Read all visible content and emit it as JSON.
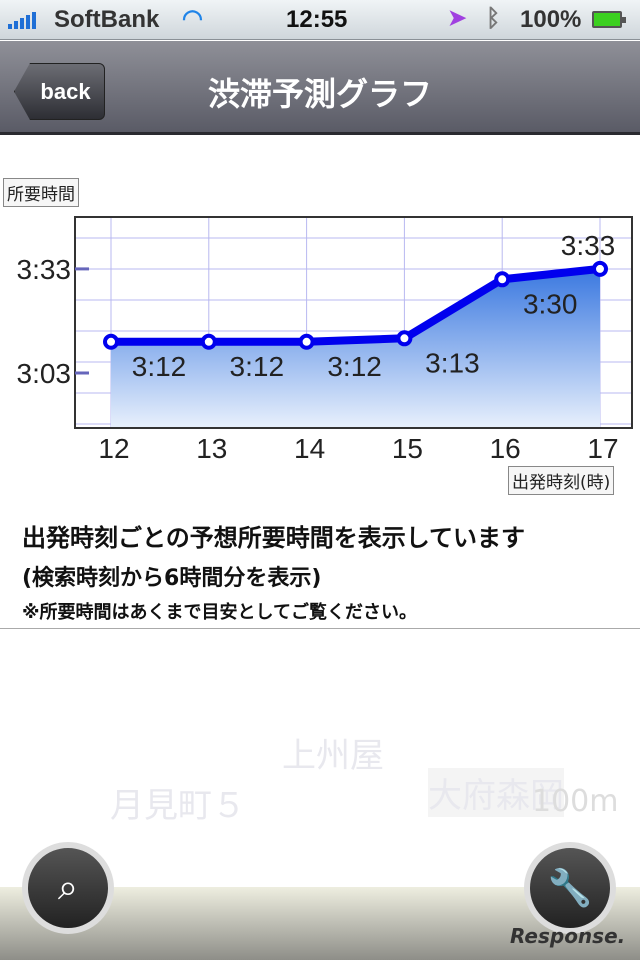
{
  "status": {
    "carrier": "SoftBank",
    "time": "12:55",
    "battery": "100%"
  },
  "nav": {
    "back_label": "back",
    "title": "渋滞予測グラフ"
  },
  "chart_data": {
    "type": "area",
    "x": [
      12,
      13,
      14,
      15,
      16,
      17
    ],
    "values_minutes": [
      192,
      192,
      192,
      193,
      210,
      213
    ],
    "data_labels": [
      "3:12",
      "3:12",
      "3:12",
      "3:13",
      "3:30",
      "3:33"
    ],
    "ylabel": "所要時間",
    "xlabel": "出発時刻(時)",
    "y_ticks": [
      "3:03",
      "3:33"
    ],
    "x_ticks": [
      "12",
      "13",
      "14",
      "15",
      "16",
      "17"
    ],
    "grid": true,
    "line_color": "#0000ee"
  },
  "info": {
    "line1": "出発時刻ごとの予想所要時間を表示しています",
    "line2": "(検索時刻から6時間分を表示)",
    "line3": "※所要時間はあくまで目安としてご覧ください。"
  },
  "map": {
    "labels": [
      "上州屋",
      "月見町５",
      "大府森岡"
    ],
    "scale": "100m"
  },
  "watermark": "Response."
}
